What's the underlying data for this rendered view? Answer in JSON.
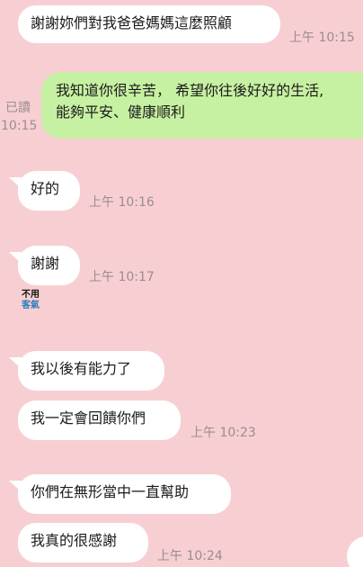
{
  "messages": [
    {
      "text": "謝謝妳們對我爸爸媽媽這麼照顧",
      "time": "上午 10:15"
    },
    {
      "line1": "我知道你很辛苦， 希望你往後好好的生活,",
      "line2": "能夠平安、健康順利",
      "read": "已讀",
      "time": "10:15"
    },
    {
      "text": "好的",
      "time": "上午 10:16"
    },
    {
      "text": "謝謝",
      "time": "上午 10:17"
    },
    {
      "text": "我以後有能力了"
    },
    {
      "text": "我一定會回饋你們",
      "time": "上午 10:23"
    },
    {
      "text": "你們在無形當中一直幫助"
    },
    {
      "text": "我真的很感謝",
      "time": "上午 10:24"
    }
  ],
  "sticker": {
    "line1": "不用",
    "line2": "客氣"
  },
  "colors": {
    "background": "#f7cfd2",
    "incoming": "#ffffff",
    "outgoing": "#c7f1a2",
    "meta": "#9c8c8e"
  }
}
